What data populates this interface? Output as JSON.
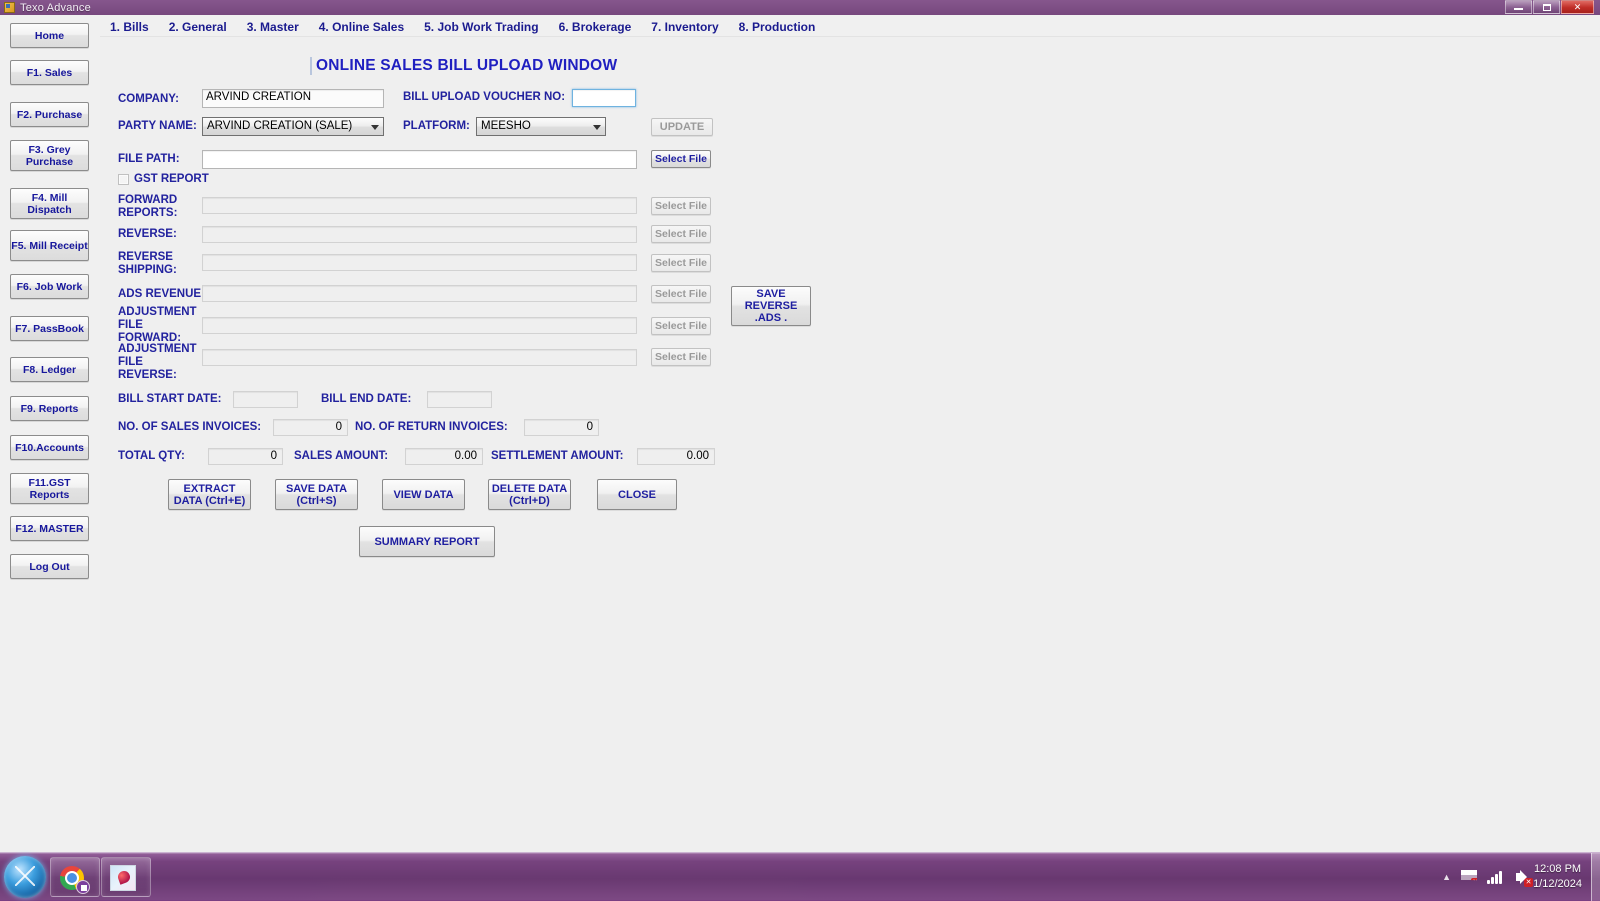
{
  "window": {
    "title": "Texo Advance",
    "icon": "application-icon",
    "controls": {
      "minimize": "minimize-icon",
      "restore": "restore-icon",
      "close": "close-icon"
    }
  },
  "menu": {
    "items": [
      {
        "label": "1. Bills"
      },
      {
        "label": "2. General"
      },
      {
        "label": "3. Master"
      },
      {
        "label": "4. Online Sales"
      },
      {
        "label": "5. Job Work Trading"
      },
      {
        "label": "6. Brokerage"
      },
      {
        "label": "7. Inventory"
      },
      {
        "label": "8. Production"
      }
    ]
  },
  "sidebar": {
    "items": [
      {
        "label": "Home"
      },
      {
        "label": "F1. Sales"
      },
      {
        "label": "F2. Purchase"
      },
      {
        "label": "F3. Grey\nPurchase"
      },
      {
        "label": "F4. Mill\nDispatch"
      },
      {
        "label": "F5. Mill\nReceipt"
      },
      {
        "label": "F6. Job Work"
      },
      {
        "label": "F7. PassBook"
      },
      {
        "label": "F8. Ledger"
      },
      {
        "label": "F9. Reports"
      },
      {
        "label": "F10.Accounts"
      },
      {
        "label": "F11.GST\nReports"
      },
      {
        "label": "F12. MASTER"
      },
      {
        "label": "Log Out"
      }
    ]
  },
  "form": {
    "title": "ONLINE SALES BILL UPLOAD WINDOW",
    "company_label": "COMPANY:",
    "company_value": "ARVIND CREATION",
    "voucher_label": "BILL UPLOAD VOUCHER NO:",
    "voucher_value": "",
    "party_label": "PARTY NAME:",
    "party_value": "ARVIND CREATION (SALE)",
    "platform_label": "PLATFORM:",
    "platform_value": "MEESHO",
    "update_label": "UPDATE",
    "file_path_label": "FILE PATH:",
    "file_path_value": "",
    "select_file_label": "Select File",
    "gst_report_label": "GST REPORT",
    "gst_report_checked": false,
    "file_rows": [
      {
        "label": "FORWARD\nREPORTS:",
        "value": "",
        "button": "Select File"
      },
      {
        "label": "REVERSE:",
        "value": "",
        "button": "Select File"
      },
      {
        "label": "REVERSE\nSHIPPING:",
        "value": "",
        "button": "Select File"
      },
      {
        "label": "ADS REVENUE:",
        "value": "",
        "button": "Select File"
      },
      {
        "label": "ADJUSTMENT\nFILE\nFORWARD:",
        "value": "",
        "button": "Select File"
      },
      {
        "label": "ADJUSTMENT\nFILE\nREVERSE:",
        "value": "",
        "button": "Select File"
      }
    ],
    "save_reverse_ads_label": "SAVE\nREVERSE\n.ADS .",
    "bill_start_date_label": "BILL START DATE:",
    "bill_start_date_value": "",
    "bill_end_date_label": "BILL END DATE:",
    "bill_end_date_value": "",
    "no_sales_invoices_label": "NO. OF SALES INVOICES:",
    "no_sales_invoices_value": "0",
    "no_return_invoices_label": "NO. OF RETURN INVOICES:",
    "no_return_invoices_value": "0",
    "total_qty_label": "TOTAL QTY:",
    "total_qty_value": "0",
    "sales_amount_label": "SALES AMOUNT:",
    "sales_amount_value": "0.00",
    "settlement_amount_label": "SETTLEMENT AMOUNT:",
    "settlement_amount_value": "0.00",
    "actions": [
      {
        "label": "EXTRACT\nDATA (Ctrl+E)"
      },
      {
        "label": "SAVE DATA\n(Ctrl+S)"
      },
      {
        "label": "VIEW DATA"
      },
      {
        "label": "DELETE DATA\n(Ctrl+D)"
      },
      {
        "label": "CLOSE"
      }
    ],
    "summary_report_label": "SUMMARY REPORT"
  },
  "taskbar": {
    "start_label": "start-orb",
    "tasks": [
      {
        "name": "chrome-taskbar-button"
      },
      {
        "name": "texo-advance-taskbar-button"
      }
    ],
    "tray": {
      "show_hidden": "▲",
      "network": "network-icon",
      "volume": "volume-muted-icon",
      "flag": "action-center-icon"
    },
    "clock_time": "12:08 PM",
    "clock_date": "1/12/2024"
  },
  "colors": {
    "label_blue": "#22229e",
    "title_blue": "#1f1fc0",
    "window_bg": "#efefef",
    "taskbar_purple": "#6f3a77",
    "close_red": "#c02d27",
    "focus_blue": "#3a9ddd"
  }
}
